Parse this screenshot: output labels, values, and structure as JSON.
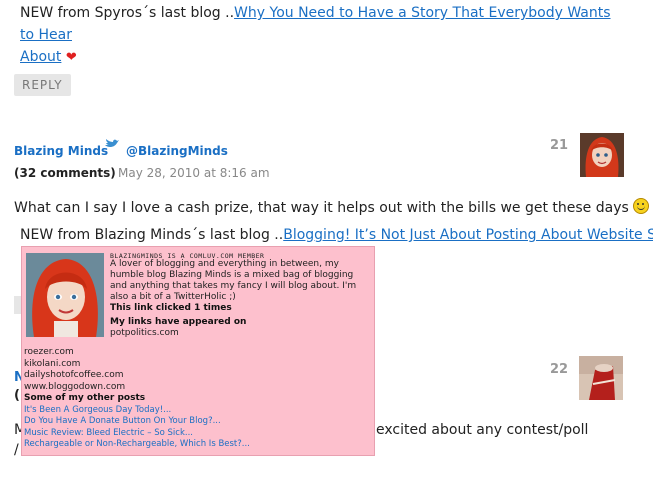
{
  "top_luv": {
    "prefix": "NEW from Spyros´s last blog ..",
    "link_line1": "Why You Need to Have a Story That Everybody Wants to Hear",
    "link_line2": "About"
  },
  "reply_label": "REPLY",
  "comment21": {
    "author": "Blazing Minds",
    "twitter": "@BlazingMinds",
    "comments_count": "(32 comments)",
    "date": "May 28, 2010 at 8:16 am",
    "number": "21",
    "text": "What can I say I love a cash prize, that way it helps out with the bills we get these days",
    "luv_prefix": "NEW from Blazing Minds´s last blog ..",
    "luv_link": "Blogging! It’s Not Just About Posting About Website SEO.."
  },
  "comment22": {
    "number": "22",
    "author_partial": "N",
    "text_partial_left": "M",
    "text_partial_right": "excited about any contest/poll",
    "text_partial_left2": "/"
  },
  "popup": {
    "header": "BLAZINGMINDS IS A COMLUV.COM MEMBER",
    "bio": "A lover of blogging and everything in between, my humble blog Blazing Minds is a mixed bag of blogging and anything that takes my fancy I will blog about. I'm also a bit of a TwitterHolic ;)",
    "clicked": "This link clicked 1 times",
    "appeared": "My links have appeared on",
    "sites": [
      "potpolitics.com",
      "roezer.com",
      "kikolani.com",
      "dailyshotofcoffee.com",
      "www.bloggodown.com"
    ],
    "other_posts_label": "Some of my other posts",
    "posts": [
      "It's Been A Gorgeous Day Today!...",
      "Do You Have A Donate Button On Your Blog?...",
      "Music Review: Bleed Electric – So Sick...",
      "Rechargeable or Non-Rechargeable, Which Is Best?..."
    ]
  }
}
